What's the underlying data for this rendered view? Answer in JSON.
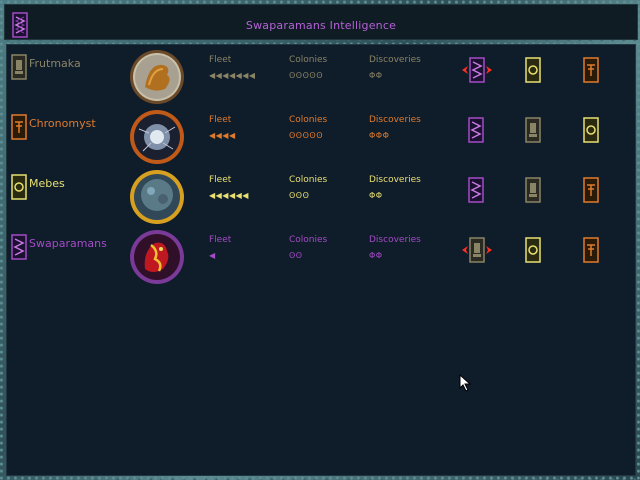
{
  "window": {
    "title": "Swaparamans Intelligence"
  },
  "columns": {
    "fleet": "Fleet",
    "colonies": "Colonies",
    "discoveries": "Discoveries"
  },
  "rows": [
    {
      "name": "Frutmaka",
      "color": "#8a8466",
      "emblem": "frutmaka-emblem-icon",
      "fleet": "◀◀◀◀◀◀◀",
      "colonies": "ʘʘʘʘʘ",
      "discoveries": "ΦΦ",
      "relations": [
        "swaparamans-emblem-war-icon",
        "mebes-emblem-icon",
        "chronomyst-emblem-icon"
      ]
    },
    {
      "name": "Chronomyst",
      "color": "#e07b2c",
      "emblem": "chronomyst-emblem-icon",
      "fleet": "◀◀◀◀",
      "colonies": "ʘʘʘʘʘ",
      "discoveries": "ΦΦΦ",
      "relations": [
        "swaparamans-emblem-icon",
        "frutmaka-emblem-icon",
        "mebes-emblem-icon"
      ]
    },
    {
      "name": "Mebes",
      "color": "#e8e070",
      "emblem": "mebes-emblem-icon",
      "fleet": "◀◀◀◀◀◀",
      "colonies": "ʘʘʘ",
      "discoveries": "ΦΦ",
      "relations": [
        "swaparamans-emblem-icon",
        "frutmaka-emblem-icon",
        "chronomyst-emblem-icon"
      ]
    },
    {
      "name": "Swaparamans",
      "color": "#a44bc6",
      "emblem": "swaparamans-emblem-icon",
      "fleet": "◀",
      "colonies": "ʘʘ",
      "discoveries": "ΦΦ",
      "relations": [
        "frutmaka-emblem-war-icon",
        "mebes-emblem-icon",
        "chronomyst-emblem-icon"
      ]
    }
  ]
}
